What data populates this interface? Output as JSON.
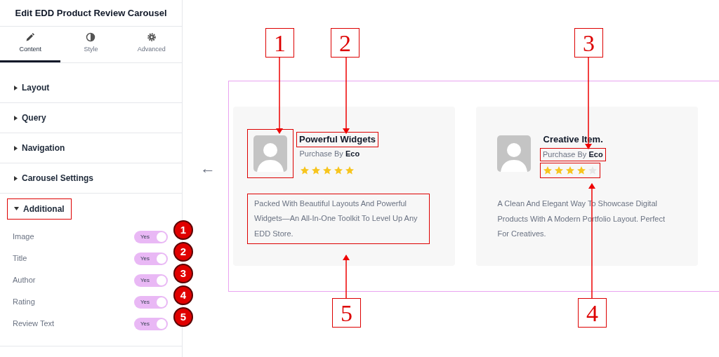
{
  "panel": {
    "title": "Edit EDD Product Review Carousel",
    "tabs": [
      {
        "label": "Content",
        "selected": true
      },
      {
        "label": "Style",
        "selected": false
      },
      {
        "label": "Advanced",
        "selected": false
      }
    ],
    "sections": [
      {
        "label": "Layout",
        "expanded": false
      },
      {
        "label": "Query",
        "expanded": false
      },
      {
        "label": "Navigation",
        "expanded": false
      },
      {
        "label": "Carousel Settings",
        "expanded": false
      },
      {
        "label": "Additional",
        "expanded": true
      }
    ],
    "toggles": [
      {
        "label": "Image",
        "value": "Yes",
        "on": true,
        "badge": "1"
      },
      {
        "label": "Title",
        "value": "Yes",
        "on": true,
        "badge": "2"
      },
      {
        "label": "Author",
        "value": "Yes",
        "on": true,
        "badge": "3"
      },
      {
        "label": "Rating",
        "value": "Yes",
        "on": true,
        "badge": "4"
      },
      {
        "label": "Review Text",
        "value": "Yes",
        "on": true,
        "badge": "5"
      }
    ]
  },
  "preview": {
    "back_arrow": "←",
    "cards": [
      {
        "title": "Powerful Widgets",
        "author_prefix": "Purchase By",
        "author": "Eco",
        "stars": 5,
        "review": "Packed With Beautiful Layouts And Powerful Widgets—An All-In-One Toolkit To Level Up Any EDD Store."
      },
      {
        "title": "Creative Item.",
        "author_prefix": "Purchase By",
        "author": "Eco",
        "stars": 4,
        "review": "A Clean And Elegant Way To Showcase Digital Products With A Modern Portfolio Layout. Perfect For Creatives."
      }
    ]
  },
  "callouts": [
    "1",
    "2",
    "3",
    "5",
    "4"
  ]
}
